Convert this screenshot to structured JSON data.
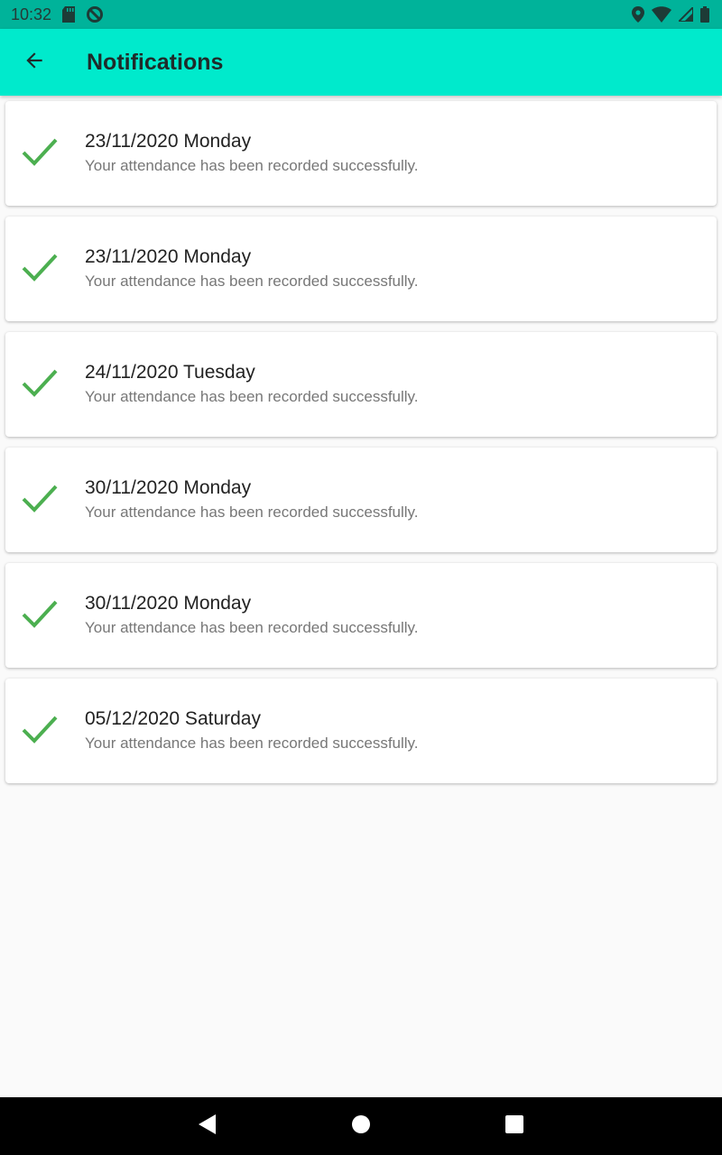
{
  "status_bar": {
    "time": "10:32",
    "icons": [
      "sd-card-icon",
      "sync-icon",
      "location-icon",
      "wifi-icon",
      "signal-icon",
      "battery-icon"
    ]
  },
  "app_bar": {
    "title": "Notifications",
    "back_icon": "arrow-back-icon",
    "background": "#00eacc"
  },
  "notifications": [
    {
      "title": "23/11/2020 Monday",
      "message": "Your attendance has been recorded successfully.",
      "icon": "check-icon"
    },
    {
      "title": "23/11/2020 Monday",
      "message": "Your attendance has been recorded successfully.",
      "icon": "check-icon"
    },
    {
      "title": "24/11/2020 Tuesday",
      "message": "Your attendance has been recorded successfully.",
      "icon": "check-icon"
    },
    {
      "title": "30/11/2020 Monday",
      "message": "Your attendance has been recorded successfully.",
      "icon": "check-icon"
    },
    {
      "title": "30/11/2020 Monday",
      "message": "Your attendance has been recorded successfully.",
      "icon": "check-icon"
    },
    {
      "title": "05/12/2020 Saturday",
      "message": "Your attendance has been recorded successfully.",
      "icon": "check-icon"
    }
  ],
  "colors": {
    "status_bar": "#00b39a",
    "check": "#4caf50"
  },
  "nav_bar": {
    "icons": [
      "nav-back-icon",
      "nav-home-icon",
      "nav-recents-icon"
    ]
  }
}
